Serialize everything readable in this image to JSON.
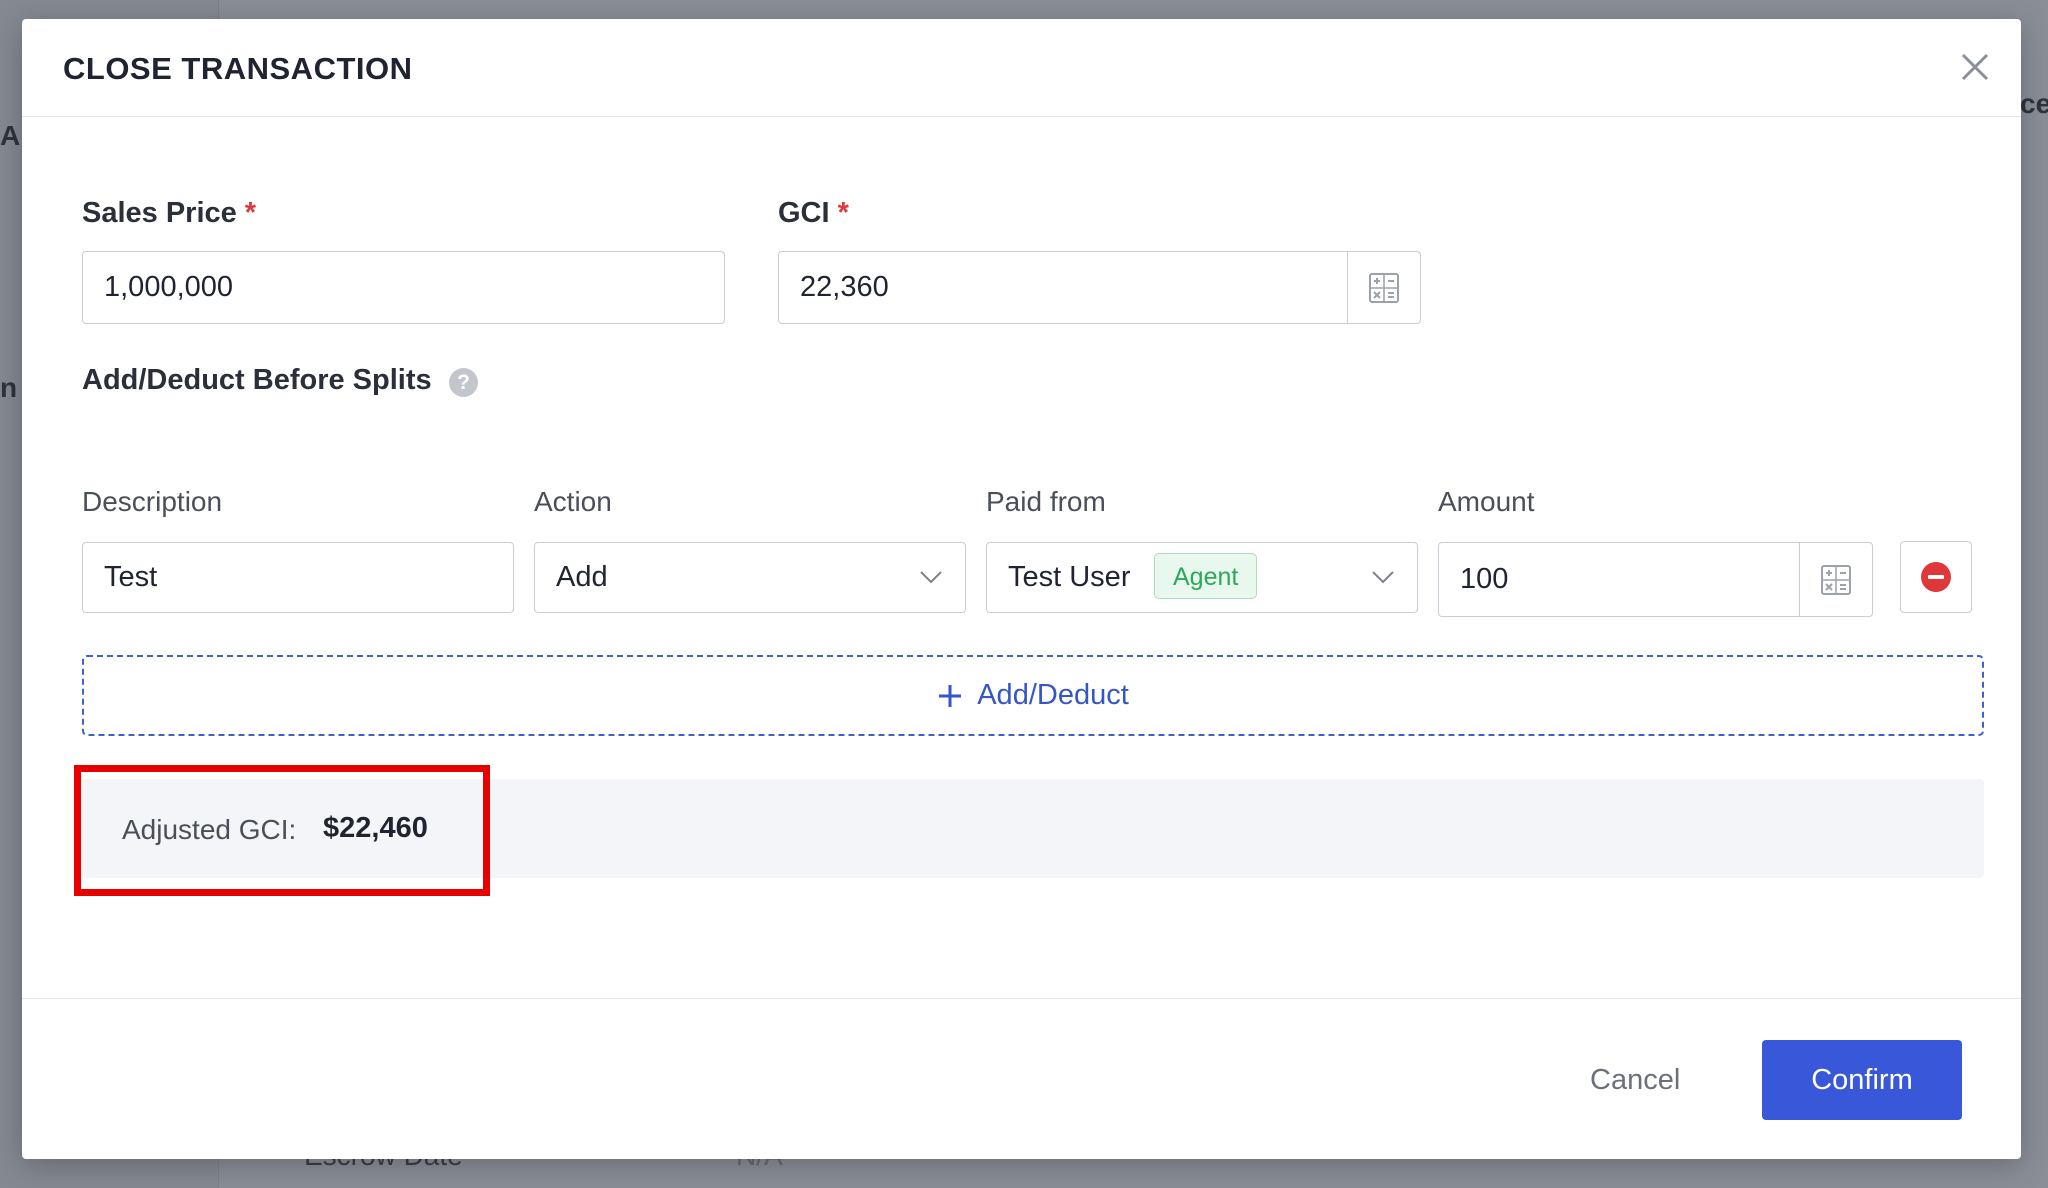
{
  "background": {
    "fragment_a": "A S",
    "fragment_n": "n",
    "fragment_cel": "cel",
    "escrow_label": "Escrow Date",
    "escrow_value": "N/A"
  },
  "modal": {
    "title": "CLOSE TRANSACTION",
    "sales_price": {
      "label": "Sales Price",
      "required_mark": "*",
      "value": "1,000,000"
    },
    "gci": {
      "label": "GCI",
      "required_mark": "*",
      "value": "22,360"
    },
    "adjust_section": {
      "label": "Add/Deduct Before Splits",
      "help": "?"
    },
    "columns": {
      "description": "Description",
      "action": "Action",
      "paid_from": "Paid from",
      "amount": "Amount"
    },
    "row": {
      "description": "Test",
      "action": "Add",
      "paid_from": "Test User",
      "paid_from_badge": "Agent",
      "amount": "100"
    },
    "add_deduct_label": "Add/Deduct",
    "adjusted_gci": {
      "label": "Adjusted GCI:",
      "value": "$22,460"
    },
    "footer": {
      "cancel": "Cancel",
      "confirm": "Confirm"
    }
  },
  "colors": {
    "primary": "#3858d9",
    "required": "#e0383a",
    "remove": "#e0383a",
    "badge_green": "#2fa857",
    "highlight": "#e60000"
  }
}
